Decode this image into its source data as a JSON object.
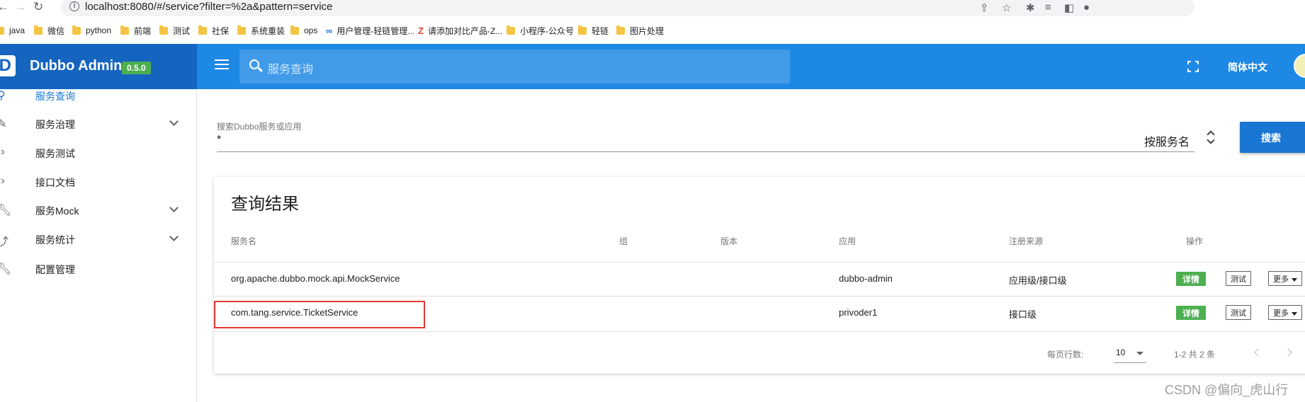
{
  "browser": {
    "url": "localhost:8080/#/service?filter=%2a&pattern=service",
    "bookmarks": [
      {
        "label": "java",
        "icon": "folder-icon"
      },
      {
        "label": "微信",
        "icon": "folder-icon"
      },
      {
        "label": "python",
        "icon": "folder-icon"
      },
      {
        "label": "前端",
        "icon": "folder-icon"
      },
      {
        "label": "测试",
        "icon": "folder-icon"
      },
      {
        "label": "社保",
        "icon": "folder-icon"
      },
      {
        "label": "系统重装",
        "icon": "folder-icon"
      },
      {
        "label": "ops",
        "icon": "folder-icon"
      },
      {
        "label": "用户管理-轻链管理...",
        "icon": "site-icon"
      },
      {
        "label": "请添加对比产品-Z...",
        "icon": "z-site-icon"
      },
      {
        "label": "小程序-公众号",
        "icon": "folder-icon"
      },
      {
        "label": "轻链",
        "icon": "folder-icon"
      },
      {
        "label": "图片处理",
        "icon": "folder-icon"
      }
    ]
  },
  "header": {
    "logo_letter": "D",
    "title": "Dubbo Admin",
    "version": "0.5.0",
    "search_placeholder": "服务查询",
    "language": "简体中文",
    "brand_color": "#1565c0",
    "bar_color": "#1e88e5"
  },
  "sidebar": {
    "items": [
      {
        "label": "服务查询",
        "icon": "search-icon",
        "active": true
      },
      {
        "label": "服务治理",
        "icon": "pencil-icon",
        "expandable": true
      },
      {
        "label": "服务测试",
        "icon": "code-icon"
      },
      {
        "label": "接口文档",
        "icon": "code-icon"
      },
      {
        "label": "服务Mock",
        "icon": "wrench-icon",
        "expandable": true
      },
      {
        "label": "服务统计",
        "icon": "chart-line-icon",
        "expandable": true
      },
      {
        "label": "配置管理",
        "icon": "wrench-icon"
      }
    ]
  },
  "search": {
    "label": "搜索Dubbo服务或应用",
    "value": "*",
    "type": "按服务名",
    "button": "搜索"
  },
  "results": {
    "title": "查询结果",
    "columns": [
      "服务名",
      "组",
      "版本",
      "应用",
      "注册来源",
      "操作"
    ],
    "rows": [
      {
        "service": "org.apache.dubbo.mock.api.MockService",
        "group": "",
        "version": "",
        "app": "dubbo-admin",
        "source": "应用级/接口级"
      },
      {
        "service": "com.tang.service.TicketService",
        "group": "",
        "version": "",
        "app": "privoder1",
        "source": "接口级"
      }
    ],
    "actions": {
      "detail": "详情",
      "test": "测试",
      "more": "更多"
    },
    "pagination": {
      "rows_per_page_label": "每页行数:",
      "rows_per_page": "10",
      "range": "1-2 共 2 条"
    }
  },
  "watermark": "CSDN @偏向_虎山行",
  "colors": {
    "accent": "#1976d2",
    "success": "#4caf50",
    "highlight": "#e53935"
  }
}
